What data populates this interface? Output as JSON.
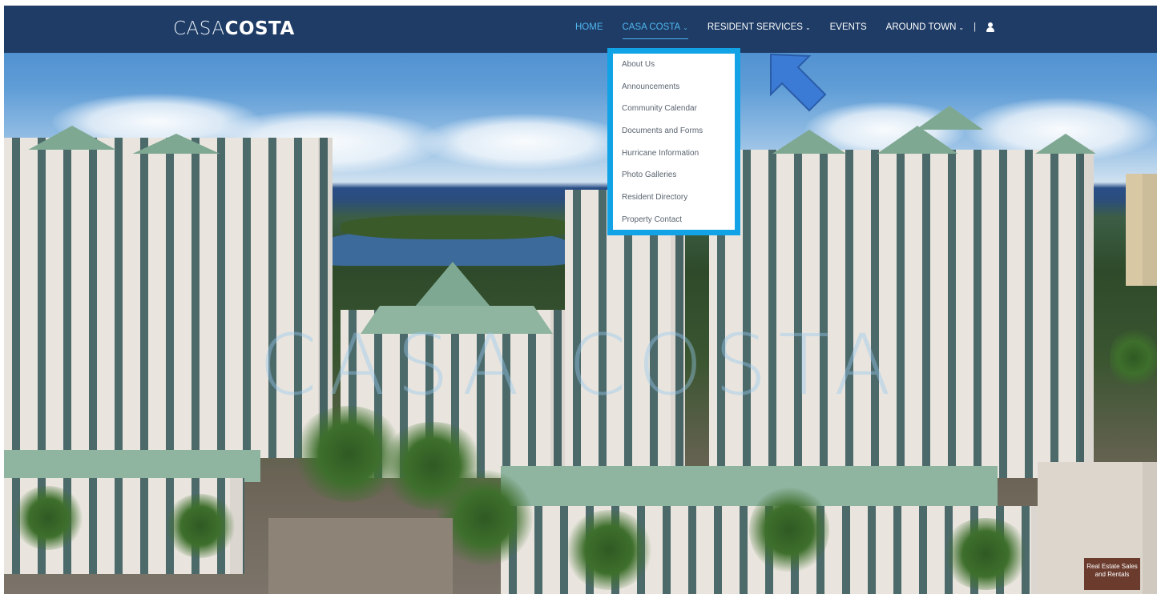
{
  "brand": {
    "logo_light": "CASA",
    "logo_bold": "COSTA"
  },
  "nav": {
    "items": [
      {
        "label": "HOME",
        "has_caret": false,
        "state": "active"
      },
      {
        "label": "CASA COSTA",
        "has_caret": true,
        "state": "open"
      },
      {
        "label": "RESIDENT SERVICES",
        "has_caret": true,
        "state": "normal"
      },
      {
        "label": "EVENTS",
        "has_caret": false,
        "state": "normal"
      },
      {
        "label": "AROUND TOWN",
        "has_caret": true,
        "state": "normal"
      }
    ],
    "separator": "|",
    "account_icon": "user-icon",
    "caret_glyph": "⌄"
  },
  "dropdown": {
    "parent": "CASA COSTA",
    "highlight_color": "#11a3e6",
    "items": [
      "About Us",
      "Announcements",
      "Community Calendar",
      "Documents and Forms",
      "Hurricane Information",
      "Photo Galleries",
      "Resident Directory",
      "Property Contact"
    ]
  },
  "hero": {
    "watermark": "CASA COSTA",
    "sign_text": "Real Estate Sales and Rentals"
  },
  "annotation": {
    "type": "arrow",
    "color": "#3b7bd6",
    "points_to": "dropdown"
  },
  "colors": {
    "navbar": "#1e3c66",
    "accent": "#4fb6ee",
    "dropdown_text": "#5a6470"
  }
}
